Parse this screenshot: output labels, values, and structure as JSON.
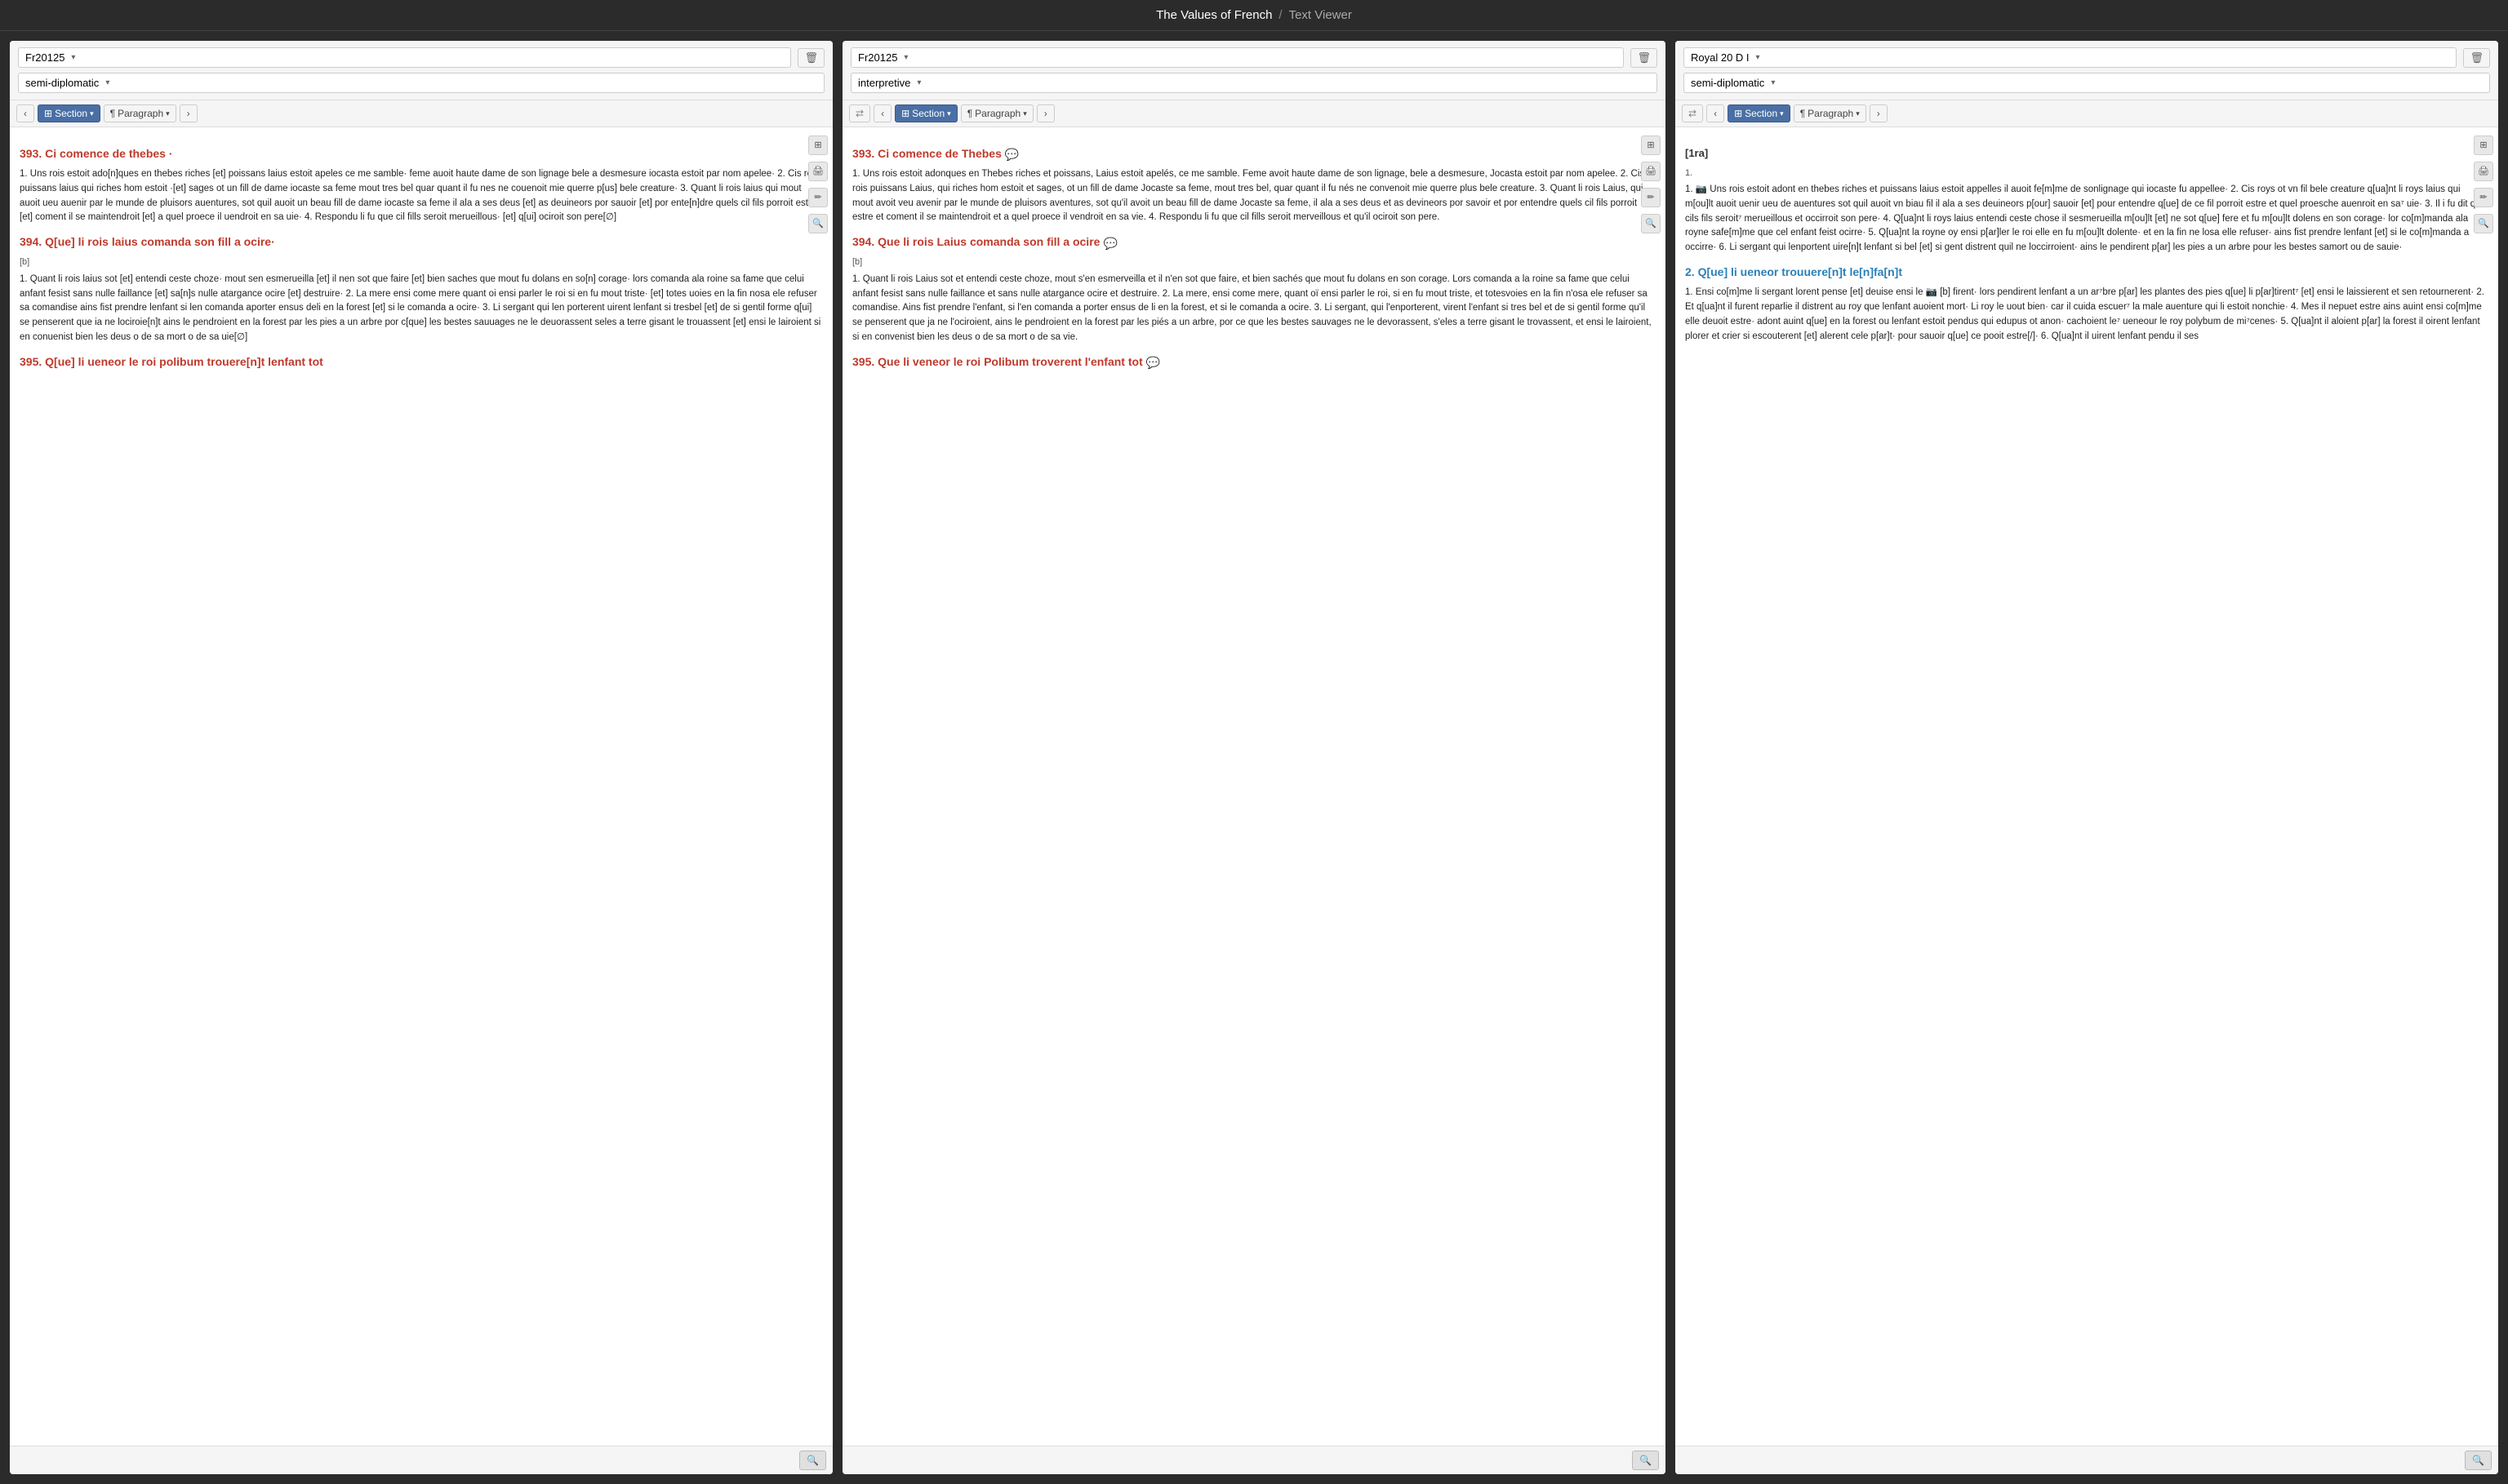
{
  "app": {
    "title": "The Values of French",
    "separator": "/",
    "subtitle": "Text Viewer"
  },
  "panels": [
    {
      "id": "panel1",
      "ms": "Fr20125",
      "mode": "semi-diplomatic",
      "has_sync": false,
      "sections": [
        {
          "heading": "393. Ci comence de thebes ·",
          "heading_color": "red",
          "subsection": null,
          "paragraphs": [
            "1. Uns rois estoit ado[n]ques en thebes riches [et] poissans laius estoit apeles ce me samble· feme auoit haute dame de son lignage bele a desmesure iocasta estoit par nom apelee· 2. Cis rois puissans laius qui riches hom estoit ·[et] sages ot un fill de dame iocaste sa feme mout tres bel quar quant il fu nes ne couenoit mie querre p[us] bele creature· 3. Quant li rois laius qui mout auoit ueu auenir par le munde de pluisors auentures, sot quil auoit un beau fill de dame iocaste sa feme il ala a ses deus [et] as deuineors por sauoir [et] por ente[n]dre quels cil fils porroit estre [et] coment il se maintendroit [et] a quel proece il uendroit en sa uie· 4. Respondu li fu que cil fills seroit merueillous· [et] q[ui] ociroit son pere[∅]"
          ]
        },
        {
          "heading": "394. Q[ue] li rois laius comanda son fill a ocire·",
          "heading_color": "red",
          "subsection": "[b]",
          "paragraphs": [
            "1. Quant li rois laius sot [et] entendi ceste choze· mout sen esmerueilla [et] il nen sot que faire [et] bien saches que mout fu dolans en so[n] corage· lors comanda ala roine sa fame que celui anfant fesist sans nulle faillance [et] sa[n]s nulle atargance ocire [et] destruire· 2. La mere ensi come mere quant oi ensi parler le roi si en fu mout triste· [et] totes uoies en la fin nosa ele refuser sa comandise ains fist prendre lenfant si len comanda aporter ensus deli en la forest [et] si le comanda a ocire· 3. Li sergant qui len porterent uirent lenfant si tresbel [et] de si gentil forme q[ui] se penserent que ia ne lociroie[n]t ains le pendroient en la forest par les pies a un arbre por c[que] les bestes sauuages ne le deuorassent seles a terre gisant le trouassent [et] ensi le lairoient si en conuenist bien les deus o de sa mort o de sa uie[∅]"
          ]
        },
        {
          "heading": "395. Q[ue] li ueneor le roi polibum trouere[n]t lenfant tot",
          "heading_color": "red",
          "subsection": null,
          "paragraphs": []
        }
      ]
    },
    {
      "id": "panel2",
      "ms": "Fr20125",
      "mode": "interpretive",
      "has_sync": true,
      "sections": [
        {
          "heading": "393. Ci comence de Thebes",
          "heading_color": "red",
          "has_chat": true,
          "subsection": null,
          "paragraphs": [
            "1. Uns rois estoit adonques en Thebes riches et poissans, Laius estoit apelés, ce me samble. Feme avoit haute dame de son lignage, bele a desmesure, Jocasta estoit par nom apelee. 2. Cis rois puissans Laius, qui riches hom estoit et sages, ot un fill de dame Jocaste sa feme, mout tres bel, quar quant il fu nés ne convenoit mie querre plus bele creature. 3. Quant li rois Laius, qui mout avoit veu avenir par le munde de pluisors aventures, sot qu'il avoit un beau fill de dame Jocaste sa feme, il ala a ses deus et as devineors por savoir et por entendre quels cil fils porroit estre et coment il se maintendroit et a quel proece il vendroit en sa vie. 4. Respondu li fu que cil fills seroit merveillous et qu'il ociroit son pere."
          ]
        },
        {
          "heading": "394. Que li rois Laius comanda son fill a ocire",
          "heading_color": "red",
          "has_chat": true,
          "subsection": "[b]",
          "paragraphs": [
            "1. Quant li rois Laius sot et entendi ceste choze, mout s'en esmerveilla et il n'en sot que faire, et bien sachés que mout fu dolans en son corage. Lors comanda a la roine sa fame que celui anfant fesist sans nulle faillance et sans nulle atargance ocire et destruire. 2. La mere, ensi come mere, quant oï ensi parler le roi, si en fu mout triste, et totesvoies en la fin n'osa ele refuser sa comandise. Ains fist prendre l'enfant, si l'en comanda a porter ensus de li en la forest, et si le comanda a ocire. 3. Li sergant, qui l'enporterent, virent l'enfant si tres bel et de si gentil forme qu'il se penserent que ja ne l'ociroient, ains le pendroient en la forest par les piés a un arbre, por ce que les bestes sauvages ne le devorassent, s'eles a terre gisant le trovassent, et ensi le lairoient, si en convenist bien les deus o de sa mort o de sa vie."
          ]
        },
        {
          "heading": "395. Que li veneor le roi Polibum troverent l'enfant tot",
          "heading_color": "red",
          "has_chat": true,
          "subsection": null,
          "paragraphs": []
        }
      ]
    },
    {
      "id": "panel3",
      "ms": "Royal 20 D I",
      "mode": "semi-diplomatic",
      "has_sync": true,
      "sections": [
        {
          "heading": "[1ra]",
          "heading_color": "black",
          "subsection": "1.",
          "paragraphs": [
            "1. 📷 Uns rois estoit adont en thebes riches et puissans laius estoit appelles il auoit fe[m]me de sonlignage qui iocaste fu appellee· 2. Cis roys ot vn fil bele creature q[ua]nt li roys laius qui m[ou]lt auoit uenir ueu de auentures sot quil auoit vn biau fil il ala a ses deuineors p[our] sauoir [et] pour entendre q[ue] de ce fil porroit estre et quel proesche auenroit en sa⁷ uie· 3. Il i fu dit que cils fils seroit⁷ merueillous et occirroit son pere· 4. Q[ua]nt li roys laius entendi ceste chose il sesmerueilla m[ou]lt [et] ne sot q[ue] fere et fu m[ou]lt dolens en son corage· lor co[m]manda ala royne safe[m]me que cel enfant feist ocirre· 5. Q[ua]nt la royne oy ensi p[ar]ler le roi elle en fu m[ou]lt dolente· et en la fin ne losa elle refuser· ains fist prendre lenfant [et] si le co[m]manda a occirre· 6. Li sergant qui lenportent uire[n]t lenfant si bel [et] si gent distrent quil ne loccirroient· ains le pendirent p[ar] les pies a un arbre pour les bestes samort ou de sauie·"
          ]
        },
        {
          "heading": "2. Q[ue] li ueneor trouuere[n]t le[n]fa[n]t",
          "heading_color": "blue",
          "subsection": null,
          "paragraphs": [
            "1. Ensi co[m]me li sergant lorent pense [et] deuise ensi le 📷 [b] firent· lors pendirent lenfant a un ar⁷bre p[ar] les plantes des pies q[ue] li p[ar]tirent⁷ [et] ensi le laissierent et sen retournerent· 2. Et q[ua]nt il furent reparlie il distrent au roy que lenfant auoient mort· Li roy le uout bien· car il cuida escuer⁷ la male auenture qui li estoit nonchie· 4. Mes il nepuet estre ains auint ensi co[m]me elle deuoit estre· adont auint q[ue] en la forest ou lenfant estoit pendus qui edupus ot anon· cachoient le⁷ ueneour le roy polybum de mi⁷cenes· 5. Q[ua]nt il aloient p[ar] la forest il oirent lenfant plorer et crier si escouterent [et] alerent cele p[ar]t· pour sauoir q[ue] ce pooit estre[/]· 6. Q[ua]nt il uirent lenfant pendu il ses"
          ]
        }
      ]
    }
  ],
  "toolbar": {
    "section_label": "Section",
    "paragraph_label": "Paragraph",
    "prev_label": "‹",
    "next_label": "›",
    "delete_label": "✕",
    "sync_label": "⇄"
  }
}
